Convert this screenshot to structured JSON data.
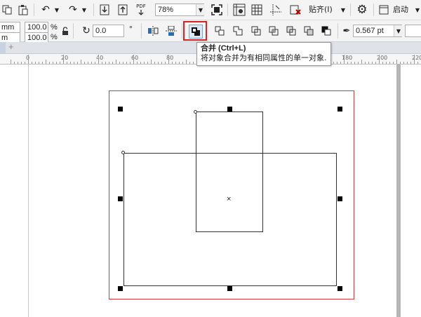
{
  "toolbar1": {
    "zoom_value": "78%",
    "pdf_label": "PDF",
    "snap_label": "贴齐(I)",
    "launch_label": "启动",
    "icons": [
      "copy-icon",
      "paste-icon",
      "undo-icon",
      "redo-icon",
      "import-icon",
      "export-icon",
      "pdf-icon",
      "zoom-dropdown-icon",
      "full-screen-icon",
      "show-rulers-icon",
      "show-grid-icon",
      "show-guidelines-icon",
      "snap-icon",
      "settings-icon",
      "launch-icon"
    ]
  },
  "toolbar2": {
    "size_unit_1": "mm",
    "size_unit_2": "m",
    "scale_x": "100.0",
    "scale_y": "100.0",
    "percent_1": "%",
    "percent_2": "%",
    "rotation_value": "0.0",
    "degree_symbol": "°",
    "outline_width": "0.567 pt"
  },
  "tooltip": {
    "title": "合并 (Ctrl+L)",
    "description": "将对象合并为有相同属性的单一对象."
  },
  "tabstrip": {
    "add_tab_symbol": "+"
  },
  "ruler": {
    "labels": [
      "0",
      "20",
      "40",
      "60",
      "80",
      "100",
      "120",
      "140",
      "160",
      "180",
      "200",
      "220"
    ]
  },
  "colors": {
    "highlight_border": "#e02020",
    "page_border": "#d43a3a",
    "toolbar_bg": "#f4f4f4"
  }
}
